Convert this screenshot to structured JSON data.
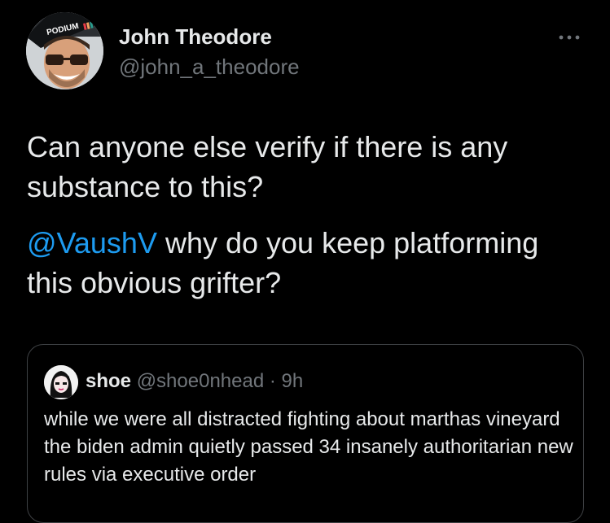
{
  "tweet": {
    "author": {
      "name": "John Theodore",
      "handle": "@john_a_theodore",
      "avatar_badge_text": "PODIUM"
    },
    "more_icon": "more-horizontal-icon",
    "text_line_1": "Can anyone else verify if there is any substance to this?",
    "mention": "@VaushV",
    "text_line_2_rest": " why do you keep platforming this obvious grifter?"
  },
  "quote": {
    "name": "shoe",
    "handle": "@shoe0nhead",
    "separator": "·",
    "time": "9h",
    "text": "while we were all distracted fighting about marthas vineyard the biden admin quietly passed 34 insanely authoritarian new rules via executive order"
  },
  "colors": {
    "background": "#000000",
    "text_primary": "#e7e9ea",
    "text_secondary": "#71767b",
    "link": "#1d9bf0",
    "border": "#3e4144"
  }
}
